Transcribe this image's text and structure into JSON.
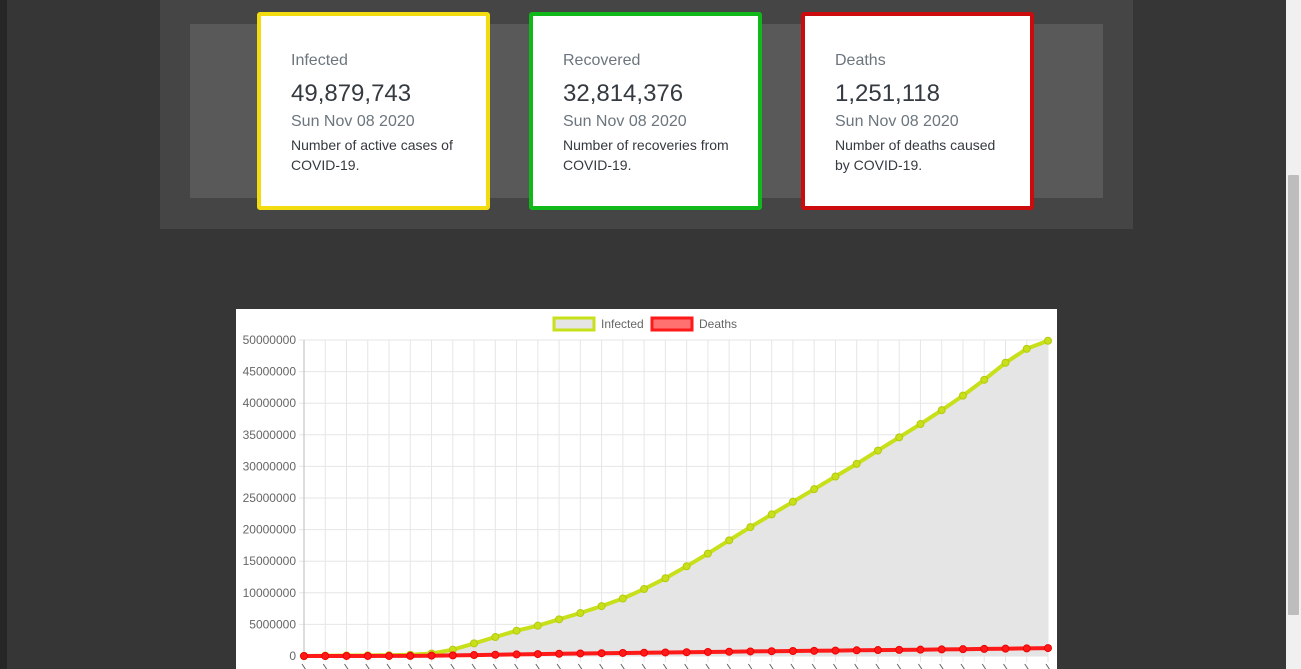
{
  "stats": {
    "infected": {
      "label": "Infected",
      "count": "49,879,743",
      "date": "Sun Nov 08 2020",
      "description": "Number of active cases of COVID-19.",
      "border_color": "#f2dc0f"
    },
    "recovered": {
      "label": "Recovered",
      "count": "32,814,376",
      "date": "Sun Nov 08 2020",
      "description": "Number of recoveries from COVID-19.",
      "border_color": "#11b81a"
    },
    "deaths": {
      "label": "Deaths",
      "count": "1,251,118",
      "date": "Sun Nov 08 2020",
      "description": "Number of deaths caused by COVID-19.",
      "border_color": "#cc0c0c"
    }
  },
  "chart_data": {
    "type": "line",
    "title": "",
    "legend_position": "top",
    "grid": true,
    "ylim": [
      0,
      50000000
    ],
    "yticks": [
      0,
      5000000,
      10000000,
      15000000,
      20000000,
      25000000,
      30000000,
      35000000,
      40000000,
      45000000,
      50000000
    ],
    "x_count": 36,
    "series": [
      {
        "name": "Infected",
        "color": "#c8e01a",
        "fill": "#e5e5e5",
        "values": [
          0,
          50000,
          80000,
          90000,
          120000,
          200000,
          400000,
          1000000,
          2000000,
          3000000,
          4000000,
          4800000,
          5800000,
          6800000,
          7900000,
          9100000,
          10600000,
          12300000,
          14200000,
          16200000,
          18300000,
          20400000,
          22400000,
          24400000,
          26400000,
          28400000,
          30400000,
          32500000,
          34600000,
          36700000,
          38900000,
          41200000,
          43700000,
          46400000,
          48600000,
          49879743
        ]
      },
      {
        "name": "Deaths",
        "color": "#ff1a1a",
        "fill": "#ff7070",
        "values": [
          0,
          1000,
          3000,
          4000,
          8000,
          20000,
          50000,
          100000,
          150000,
          200000,
          250000,
          300000,
          350000,
          400000,
          440000,
          480000,
          520000,
          560000,
          600000,
          640000,
          680000,
          720000,
          760000,
          790000,
          820000,
          860000,
          900000,
          940000,
          970000,
          1000000,
          1040000,
          1080000,
          1120000,
          1160000,
          1200000,
          1251118
        ]
      }
    ]
  }
}
